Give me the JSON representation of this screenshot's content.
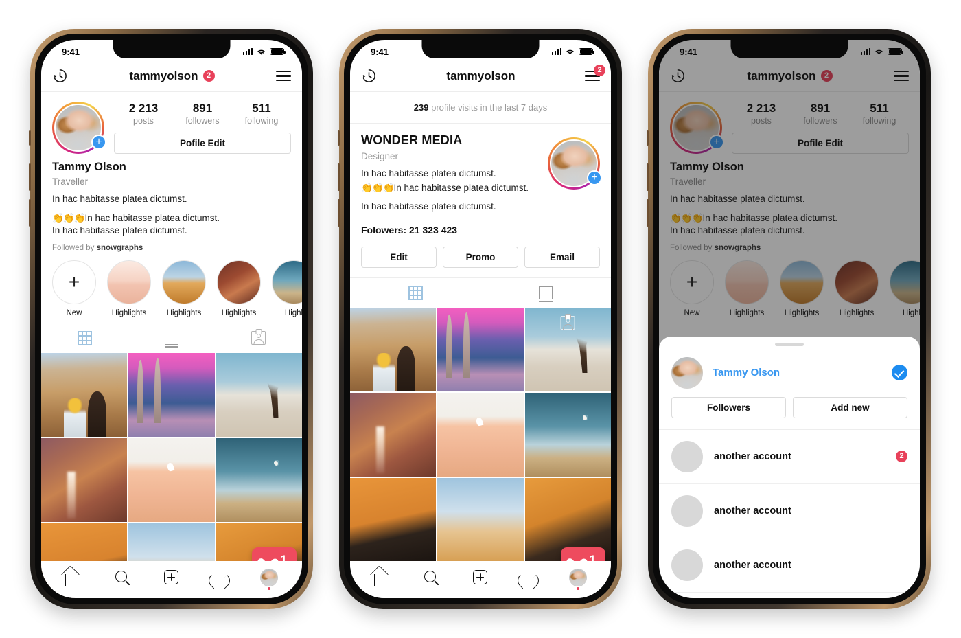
{
  "status_bar": {
    "time": "9:41",
    "signal_icon": "signal-bars-icon",
    "wifi_icon": "wifi-icon",
    "battery_icon": "battery-icon"
  },
  "phone1": {
    "nav": {
      "history_icon": "clock-history-icon",
      "username": "tammyolson",
      "badge": "2",
      "menu_icon": "hamburger-menu-icon"
    },
    "profile": {
      "avatar": "profile-avatar",
      "add_story_icon": "plus-icon",
      "stats": [
        {
          "num": "2 213",
          "label": "posts"
        },
        {
          "num": "891",
          "label": "followers"
        },
        {
          "num": "511",
          "label": "following"
        }
      ],
      "edit_button": "Pofile Edit",
      "fullname": "Tammy Olson",
      "role": "Traveller",
      "bio_line_1": "In hac habitasse platea dictumst.",
      "bio_emoji": "👏👏👏",
      "bio_line_2": "In hac habitasse platea dictumst.",
      "bio_line_3": "In hac habitasse platea dictumst.",
      "followed_by_prefix": "Followed by ",
      "followed_by_name": "snowgraphs"
    },
    "highlights": [
      {
        "label": "New",
        "icon": "plus-icon"
      },
      {
        "label": "Highlights",
        "icon": ""
      },
      {
        "label": "Highlights",
        "icon": ""
      },
      {
        "label": "Highlights",
        "icon": ""
      },
      {
        "label": "Highl",
        "icon": ""
      }
    ],
    "tabs": [
      {
        "name": "grid-tab",
        "icon": "grid-icon",
        "active": true
      },
      {
        "name": "card-tab",
        "icon": "card-icon",
        "active": false
      },
      {
        "name": "tagged-tab",
        "icon": "tagged-person-icon",
        "active": false
      }
    ],
    "like_popup": {
      "icon": "heart-filled-icon",
      "count": "1"
    },
    "tabbar": [
      {
        "name": "home-tab",
        "icon": "home-icon"
      },
      {
        "name": "search-tab",
        "icon": "search-icon"
      },
      {
        "name": "create-tab",
        "icon": "plus-square-icon"
      },
      {
        "name": "activity-tab",
        "icon": "heart-outline-icon"
      },
      {
        "name": "profile-tab",
        "icon": "avatar-icon"
      }
    ]
  },
  "phone2": {
    "nav": {
      "history_icon": "clock-history-icon",
      "username": "tammyolson",
      "badge": "2",
      "menu_icon": "hamburger-menu-icon"
    },
    "visits": {
      "count": "239",
      "text": " profile visits in the last 7 days"
    },
    "business": {
      "title": "WONDER MEDIA",
      "role": "Designer",
      "line_1": "In hac habitasse platea dictumst.",
      "emoji": "👏👏👏",
      "line_2": "In hac habitasse platea dictumst.",
      "line_3": "In hac habitasse platea dictumst.",
      "followers": "Folowers: 21 323 423",
      "avatar": "profile-avatar",
      "add_story_icon": "plus-icon"
    },
    "buttons": [
      "Edit",
      "Promo",
      "Email"
    ],
    "tabs": [
      {
        "name": "grid-tab",
        "icon": "grid-icon",
        "active": true
      },
      {
        "name": "card-tab",
        "icon": "card-icon",
        "active": false
      }
    ],
    "like_popup": {
      "icon": "heart-filled-icon",
      "count": "1"
    }
  },
  "phone3": {
    "sheet": {
      "grabber": "drag-handle",
      "current_account": {
        "name": "Tammy Olson",
        "check_icon": "check-circle-icon",
        "avatar": "profile-avatar"
      },
      "buttons": [
        "Followers",
        "Add new"
      ],
      "accounts": [
        {
          "name": "another account",
          "badge": "2",
          "avatar": "crowd-avatar"
        },
        {
          "name": "another account",
          "badge": "",
          "avatar": "placeholder-avatar"
        },
        {
          "name": "another account",
          "badge": "",
          "avatar": "placeholder-avatar"
        }
      ]
    }
  },
  "colors": {
    "accent_blue": "#3897f0",
    "badge_red": "#e8415a",
    "like_red": "#ee4b5e",
    "check_blue": "#1d8cf0",
    "muted_text": "#8c8c8c",
    "border": "#dbdbdb"
  }
}
